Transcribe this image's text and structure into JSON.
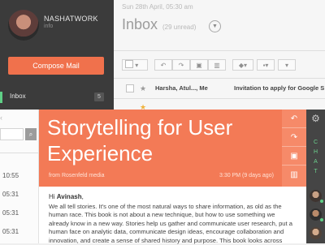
{
  "user": {
    "name": "NASHATWORK",
    "subtitle": "info"
  },
  "sidebar": {
    "compose_label": "Compose Mail",
    "inbox_label": "Inbox",
    "inbox_count": "5"
  },
  "inbox": {
    "date": "Sun 28th April, 05:30 am",
    "title": "Inbox",
    "unread": "(29 unread)",
    "rows": [
      {
        "sender": "Harsha, Atul..., Me",
        "subject": "Invitation to apply for Google S"
      }
    ]
  },
  "left_list": {
    "times": [
      "10:55",
      "05:31",
      "05:31",
      "05:31"
    ]
  },
  "message": {
    "subject": "Storytelling for User Experience",
    "from": "from Rosenfeld media",
    "time": "3:30 PM (9 days ago)",
    "greeting_prefix": "Hi ",
    "greeting_name": "Avinash",
    "greeting_suffix": ",",
    "body": "We all tell stories. It's one of the most natural ways to share information, as old as the human race. This book is not about a new technique, but how to use something we already know in a new way. Stories help us gather and communicate user research, put a human face on analytic data, communicate design ideas, encourage collaboration and innovation, and create a sense of shared history and purpose. This book looks across"
  },
  "chat": {
    "letters": [
      "C",
      "H",
      "A",
      "T"
    ]
  },
  "icons": {
    "inbox_dropdown": "chevron-down-icon",
    "toolbar": [
      "reply-icon",
      "forward-icon",
      "archive-icon",
      "trash-icon",
      "tag-icon",
      "more-icon"
    ],
    "message_actions": [
      "reply-icon",
      "forward-icon",
      "archive-icon",
      "trash-icon"
    ],
    "chat_settings": "gear-icon"
  },
  "colors": {
    "accent": "#f37a56",
    "sidebar": "#3b3b3b",
    "online": "#5fcf86",
    "chat_rail": "#454545"
  }
}
